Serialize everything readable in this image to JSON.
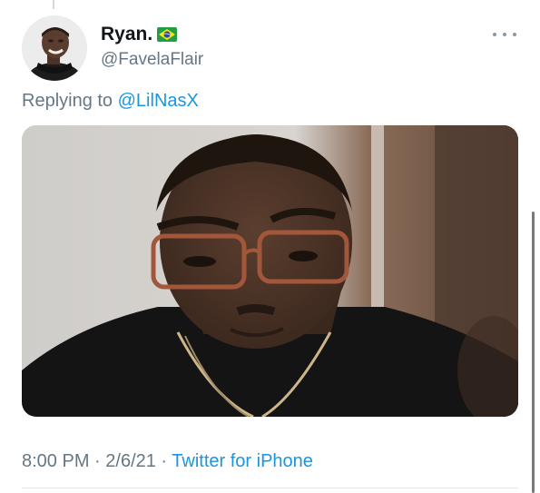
{
  "tweet": {
    "display_name": "Ryan.",
    "flag_icon": "brazil-flag-icon",
    "handle": "@FavelaFlair",
    "more_icon": "more-options-icon",
    "replying_prefix": "Replying to ",
    "replying_to": "@LilNasX",
    "media": {
      "kind": "photo",
      "subject": "man-with-glasses-reaction-image"
    },
    "time": "8:00 PM",
    "separator1": " · ",
    "date": "2/6/21",
    "separator2": " · ",
    "source": "Twitter for iPhone"
  },
  "colors": {
    "text_primary": "#14171a",
    "text_secondary": "#657786",
    "link": "#1b95e0",
    "divider": "#e1e8ed"
  }
}
